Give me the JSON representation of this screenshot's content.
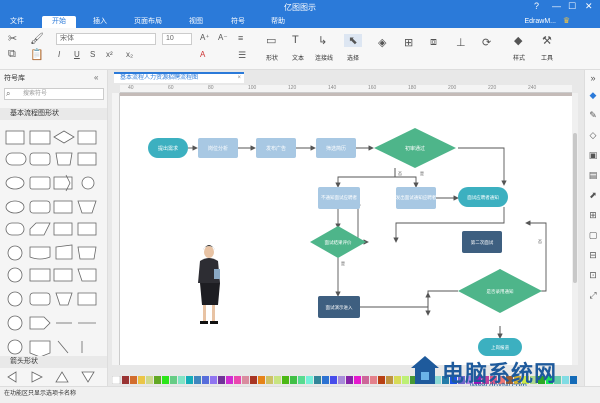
{
  "app": {
    "title": "亿图图示"
  },
  "tabs": [
    "文件",
    "开始",
    "插入",
    "页面布局",
    "视图",
    "符号",
    "帮助"
  ],
  "active_tab": "开始",
  "user": {
    "name": "EdrawM..."
  },
  "ribbon": {
    "font_name": "宋体",
    "font_size": "10",
    "tools": [
      "形状",
      "文本",
      "连接线",
      "选择"
    ],
    "style_label": "样式",
    "tools_label": "工具"
  },
  "left_panel": {
    "title": "符号库",
    "search_placeholder": "搜索符号",
    "section_basic": "基本流程图形状",
    "section_arrow": "箭头形状"
  },
  "document": {
    "tab_label": "基本流程人力资源招聘流程图",
    "ruler_marks": [
      "40",
      "60",
      "80",
      "100",
      "120",
      "140",
      "160",
      "180",
      "200",
      "220",
      "240"
    ]
  },
  "flowchart": {
    "nodes": [
      "提出需求",
      "岗位分析",
      "发布广告",
      "筛选简历",
      "初审通过",
      "不通知面试应聘者",
      "发出面试通知应聘者",
      "面试应聘者通知",
      "面试结果评价",
      "第二次面试",
      "面试演示进入",
      "是否录用通知",
      "上岗报道"
    ],
    "labels": [
      "是",
      "否",
      "是",
      "否"
    ]
  },
  "status": {
    "text": "在功能区只显示选项卡名称"
  },
  "watermark": {
    "brand": "电脑系统网",
    "url": "www.dnxtw.com"
  },
  "colors": {
    "primary": "#2b7ad9",
    "process": "#a8c8e3",
    "decision": "#4eb58a",
    "terminal": "#3cb0c0",
    "dark": "#3e5f80"
  }
}
